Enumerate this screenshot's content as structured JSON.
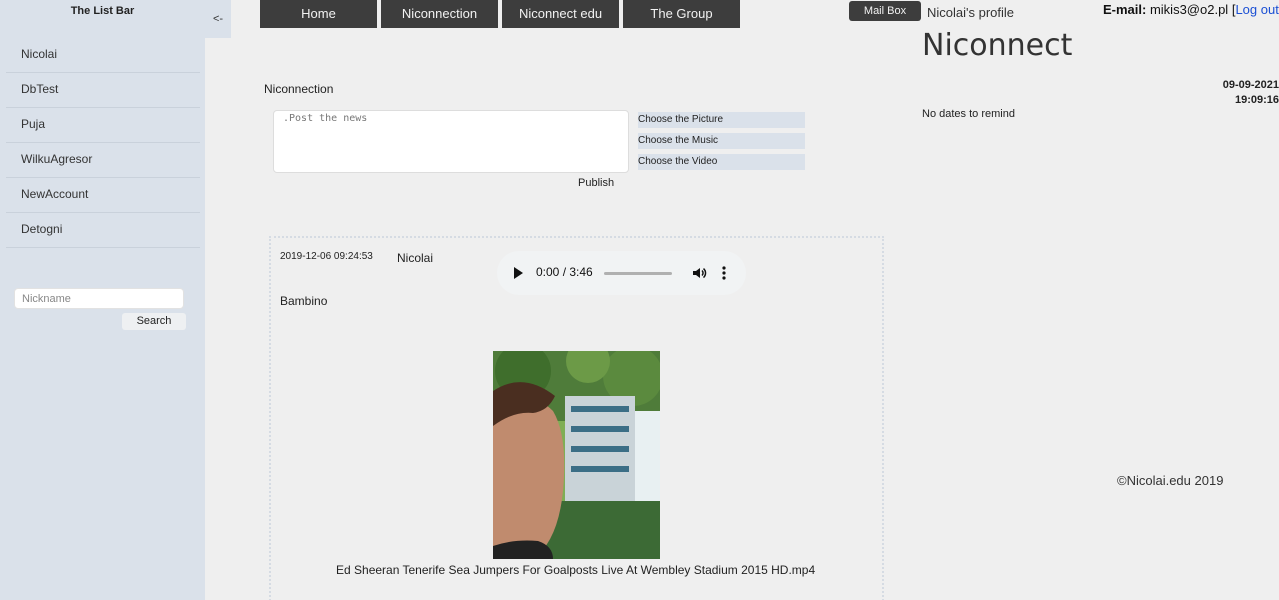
{
  "sidebar": {
    "title": "The List Bar",
    "collapse_label": "<-",
    "items": [
      {
        "label": "Nicolai"
      },
      {
        "label": "DbTest"
      },
      {
        "label": "Puja"
      },
      {
        "label": "WilkuAgresor"
      },
      {
        "label": "NewAccount"
      },
      {
        "label": "Detogni"
      }
    ],
    "search": {
      "placeholder": "Nickname",
      "button_label": "Search"
    }
  },
  "nav": {
    "items": [
      "Home",
      "Niconnection",
      "Niconnect edu",
      "The Group"
    ]
  },
  "composer": {
    "section_title": "Niconnection",
    "placeholder": ".Post the news",
    "choose_picture": "Choose the Picture",
    "choose_music": "Choose the Music",
    "choose_video": "Choose the Video",
    "publish_label": "Publish"
  },
  "post": {
    "date": "2019-12-06 09:24:53",
    "author": "Nicolai",
    "audio": {
      "time": "0:00 / 3:46",
      "progress": 0.0
    },
    "text": "Bambino",
    "video_name": "Ed Sheeran Tenerife Sea Jumpers For Goalposts Live At Wembley Stadium 2015 HD.mp4"
  },
  "header_right": {
    "mailbox_label": "Mail Box",
    "profile_label": "Nicolai's profile",
    "email_label": "E-mail:",
    "email": "mikis3@o2.pl",
    "bracket_open": "[",
    "logout_label": "Log out",
    "bracket_close": "]",
    "brand": "Niconnect",
    "date": "09-09-2021",
    "time": "19:09:16",
    "remind_text": "No dates to remind",
    "copyright": "©Nicolai.edu 2019"
  },
  "colors": {
    "sidebar_bg": "#dae1ea",
    "nav_bg": "#3d3d3d",
    "link": "#1a4fd4"
  }
}
